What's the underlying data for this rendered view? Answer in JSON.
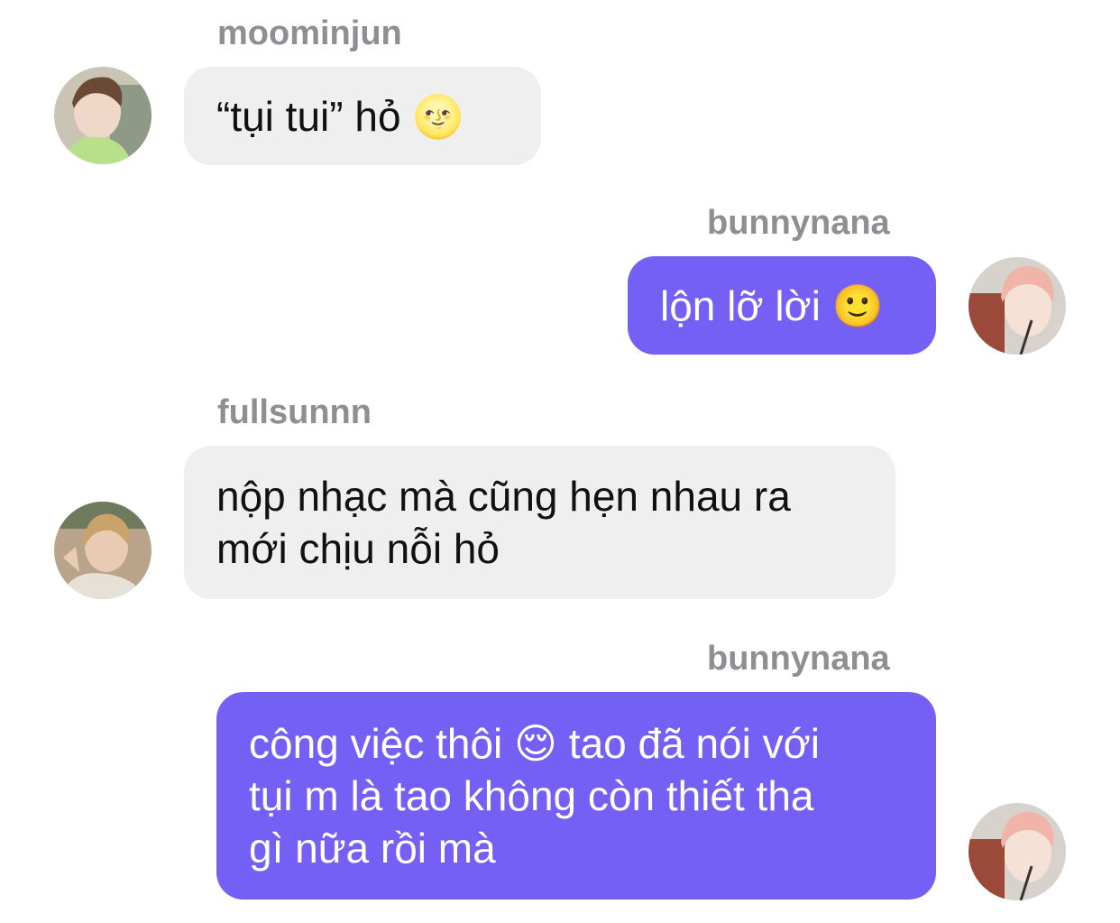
{
  "messages": [
    {
      "sender": "moominjun",
      "text": "“tụi tui” hỏ 🌝",
      "direction": "incoming"
    },
    {
      "sender": "bunnynana",
      "text": "lộn lỡ lời 🙂",
      "direction": "outgoing"
    },
    {
      "sender": "fullsunnn",
      "text": "nộp nhạc mà cũng hẹn nhau ra\nmới chịu nỗi hỏ",
      "direction": "incoming"
    },
    {
      "sender": "bunnynana",
      "text": "công việc thôi 😌 tao đã nói với\ntụi m là tao không còn thiết tha\ngì nữa rồi mà",
      "direction": "outgoing"
    }
  ],
  "colors": {
    "outgoing_bubble": "#7560f5",
    "incoming_bubble": "#efeff0",
    "sender_name": "#8e8e93"
  }
}
